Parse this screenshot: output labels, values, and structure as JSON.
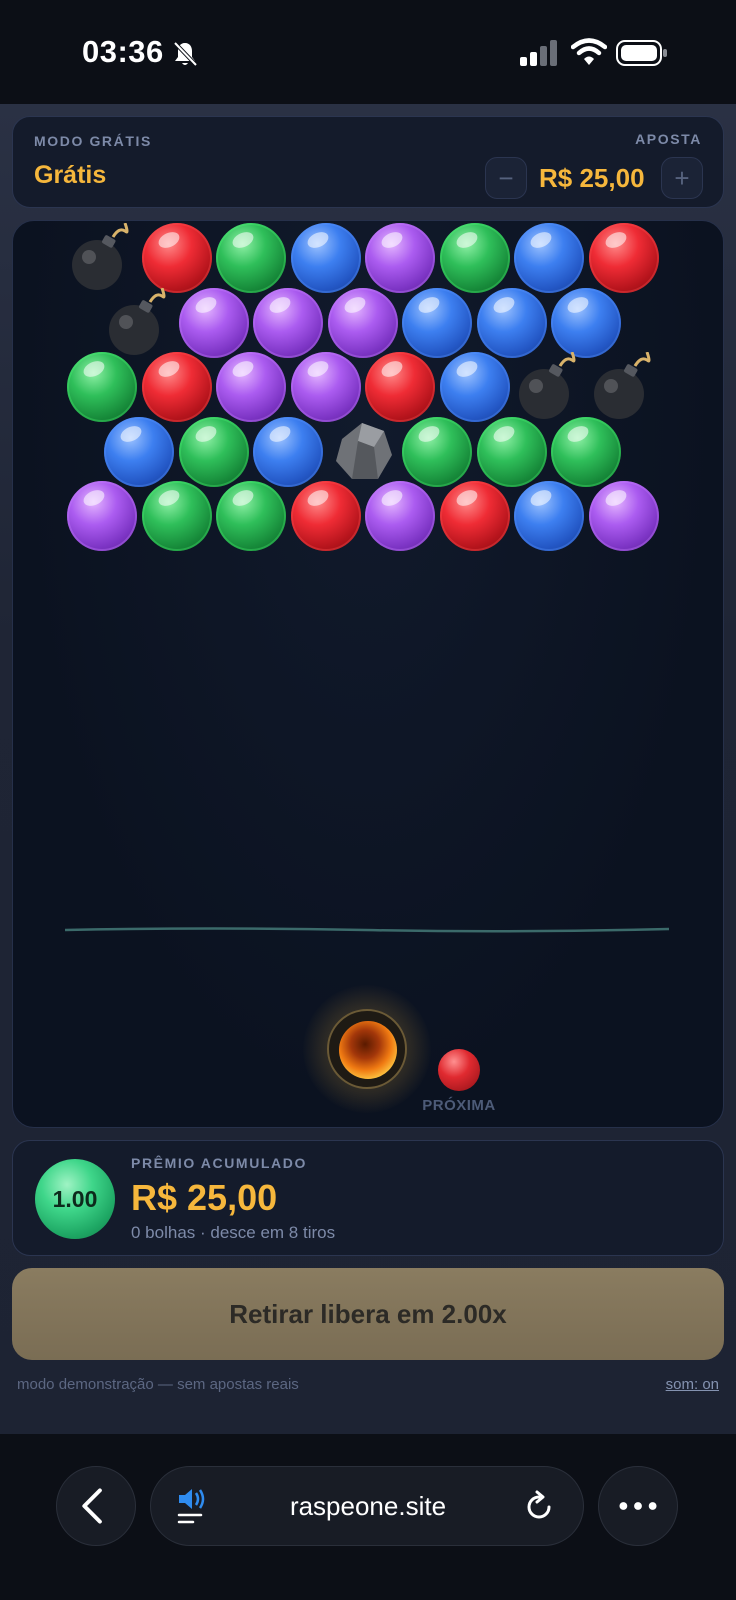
{
  "status_bar": {
    "time": "03:36"
  },
  "header": {
    "mode_label": "MODO GRÁTIS",
    "mode_value": "Grátis",
    "bet_label": "APOSTA",
    "bet_value": "R$ 25,00",
    "decrease_label": "−",
    "increase_label": "+"
  },
  "board": {
    "rows": [
      [
        "bomb",
        "red",
        "green",
        "blue",
        "purple",
        "green",
        "blue",
        "red"
      ],
      [
        "bomb",
        "purple",
        "purple",
        "purple",
        "blue",
        "blue",
        "blue"
      ],
      [
        "green",
        "red",
        "purple",
        "purple",
        "red",
        "blue",
        "bomb",
        "bomb"
      ],
      [
        "blue",
        "green",
        "blue",
        "rock",
        "green",
        "green",
        "green"
      ],
      [
        "purple",
        "green",
        "green",
        "red",
        "purple",
        "red",
        "blue",
        "purple"
      ]
    ],
    "current_ball": "fire",
    "next_ball": "red",
    "next_label": "PRÓXIMA"
  },
  "prize": {
    "multiplier": "1.00",
    "label": "PRÊMIO ACUMULADO",
    "value": "R$ 25,00",
    "subtitle": "0 bolhas · desce em 8 tiros"
  },
  "cashout_label": "Retirar libera em 2.00x",
  "footer": {
    "left": "modo demonstração — sem apostas reais",
    "right": "som: on"
  },
  "browser": {
    "url": "raspeone.site"
  },
  "colors": {
    "accent_gold": "#f6b73c",
    "muted_text": "#7d8aa8",
    "red": "#ef2c35",
    "green": "#2fbf5a",
    "blue": "#3d7ff0",
    "purple": "#ab5cf0"
  },
  "icons": [
    "bell-off-icon",
    "signal-icon",
    "wifi-icon",
    "battery-icon",
    "back-icon",
    "speaker-icon",
    "reload-icon",
    "more-icon",
    "bomb-icon",
    "rock-icon",
    "fireball-icon"
  ]
}
